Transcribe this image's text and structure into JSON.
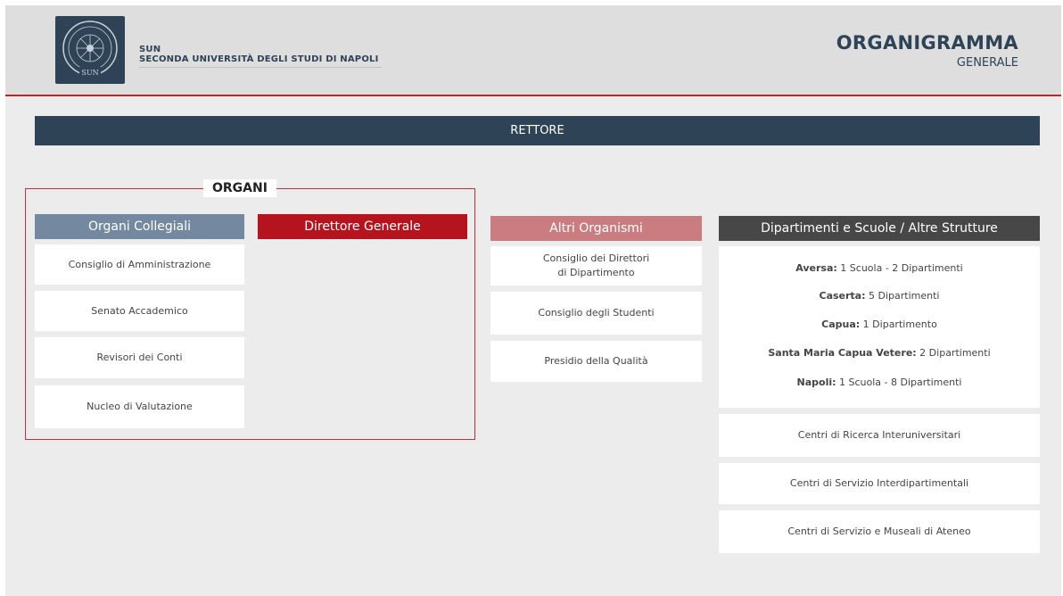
{
  "header": {
    "logo_text": "SUN",
    "uni_short": "SUN",
    "uni_full": "SECONDA UNIVERSITÀ DEGLI STUDI DI NAPOLI",
    "title": "ORGANIGRAMMA",
    "subtitle": "GENERALE"
  },
  "rettore": "RETTORE",
  "organi": {
    "label": "ORGANI",
    "collegiali": {
      "heading": "Organi Collegiali",
      "items": [
        "Consiglio di Amministrazione",
        "Senato Accademico",
        "Revisori dei Conti",
        "Nucleo di Valutazione"
      ]
    },
    "direttore": {
      "heading": "Direttore Generale"
    }
  },
  "altri": {
    "heading": "Altri Organismi",
    "items": [
      "Consiglio dei Direttori\ndi Dipartimento",
      "Consiglio degli Studenti",
      "Presidio della Qualità"
    ]
  },
  "dipartimenti": {
    "heading": "Dipartimenti e Scuole / Altre Strutture",
    "locations": [
      {
        "city": "Aversa:",
        "detail": " 1 Scuola - 2 Dipartimenti"
      },
      {
        "city": "Caserta:",
        "detail": " 5 Dipartimenti"
      },
      {
        "city": "Capua:",
        "detail": " 1 Dipartimento"
      },
      {
        "city": "Santa Maria Capua Vetere:",
        "detail": " 2 Dipartimenti"
      },
      {
        "city": "Napoli:",
        "detail": " 1 Scuola - 8 Dipartimenti"
      }
    ],
    "centri": [
      "Centri di Ricerca Interuniversitari",
      "Centri di Servizio Interdipartimentali",
      "Centri di Servizio e Museali di Ateneo"
    ]
  },
  "colors": {
    "navy": "#2f4356",
    "slate": "#7488a0",
    "red": "#b5141e",
    "rose": "#c97d80",
    "charcoal": "#474747"
  }
}
